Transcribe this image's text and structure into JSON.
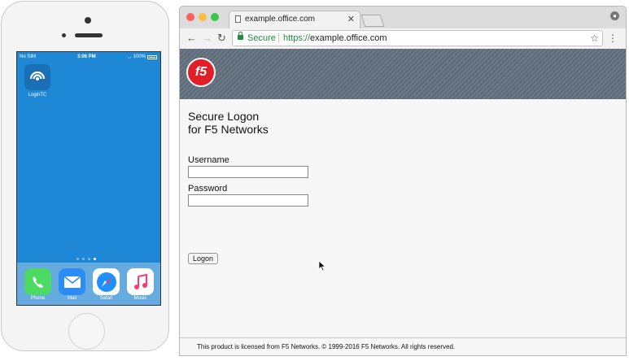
{
  "phone": {
    "status": {
      "carrier": "No SIM",
      "time": "3:06 PM",
      "battery": "100%"
    },
    "home_app": {
      "label": "LoginTC",
      "icon": "logintc-icon"
    },
    "page_dots": 4,
    "dock": [
      {
        "label": "Phone",
        "icon": "phone-icon",
        "color": "#4cd964"
      },
      {
        "label": "Mail",
        "icon": "mail-icon",
        "color": "#2c8cf4"
      },
      {
        "label": "Safari",
        "icon": "safari-icon",
        "color": "#ffffff"
      },
      {
        "label": "Music",
        "icon": "music-icon",
        "color": "#ffffff"
      }
    ]
  },
  "browser": {
    "tab_title": "example.office.com",
    "omnibox": {
      "secure_label": "Secure",
      "scheme": "https://",
      "host": "example.office.com"
    },
    "colors": {
      "secure_green": "#1e8e3e",
      "f5_red": "#e21f26"
    }
  },
  "page": {
    "logo_text": "f5",
    "heading_line1": "Secure Logon",
    "heading_line2": "for F5 Networks",
    "username_label": "Username",
    "username_value": "",
    "password_label": "Password",
    "password_value": "",
    "logon_button": "Logon",
    "footer": "This product is licensed from F5 Networks. © 1999-2016 F5 Networks. All rights reserved."
  }
}
